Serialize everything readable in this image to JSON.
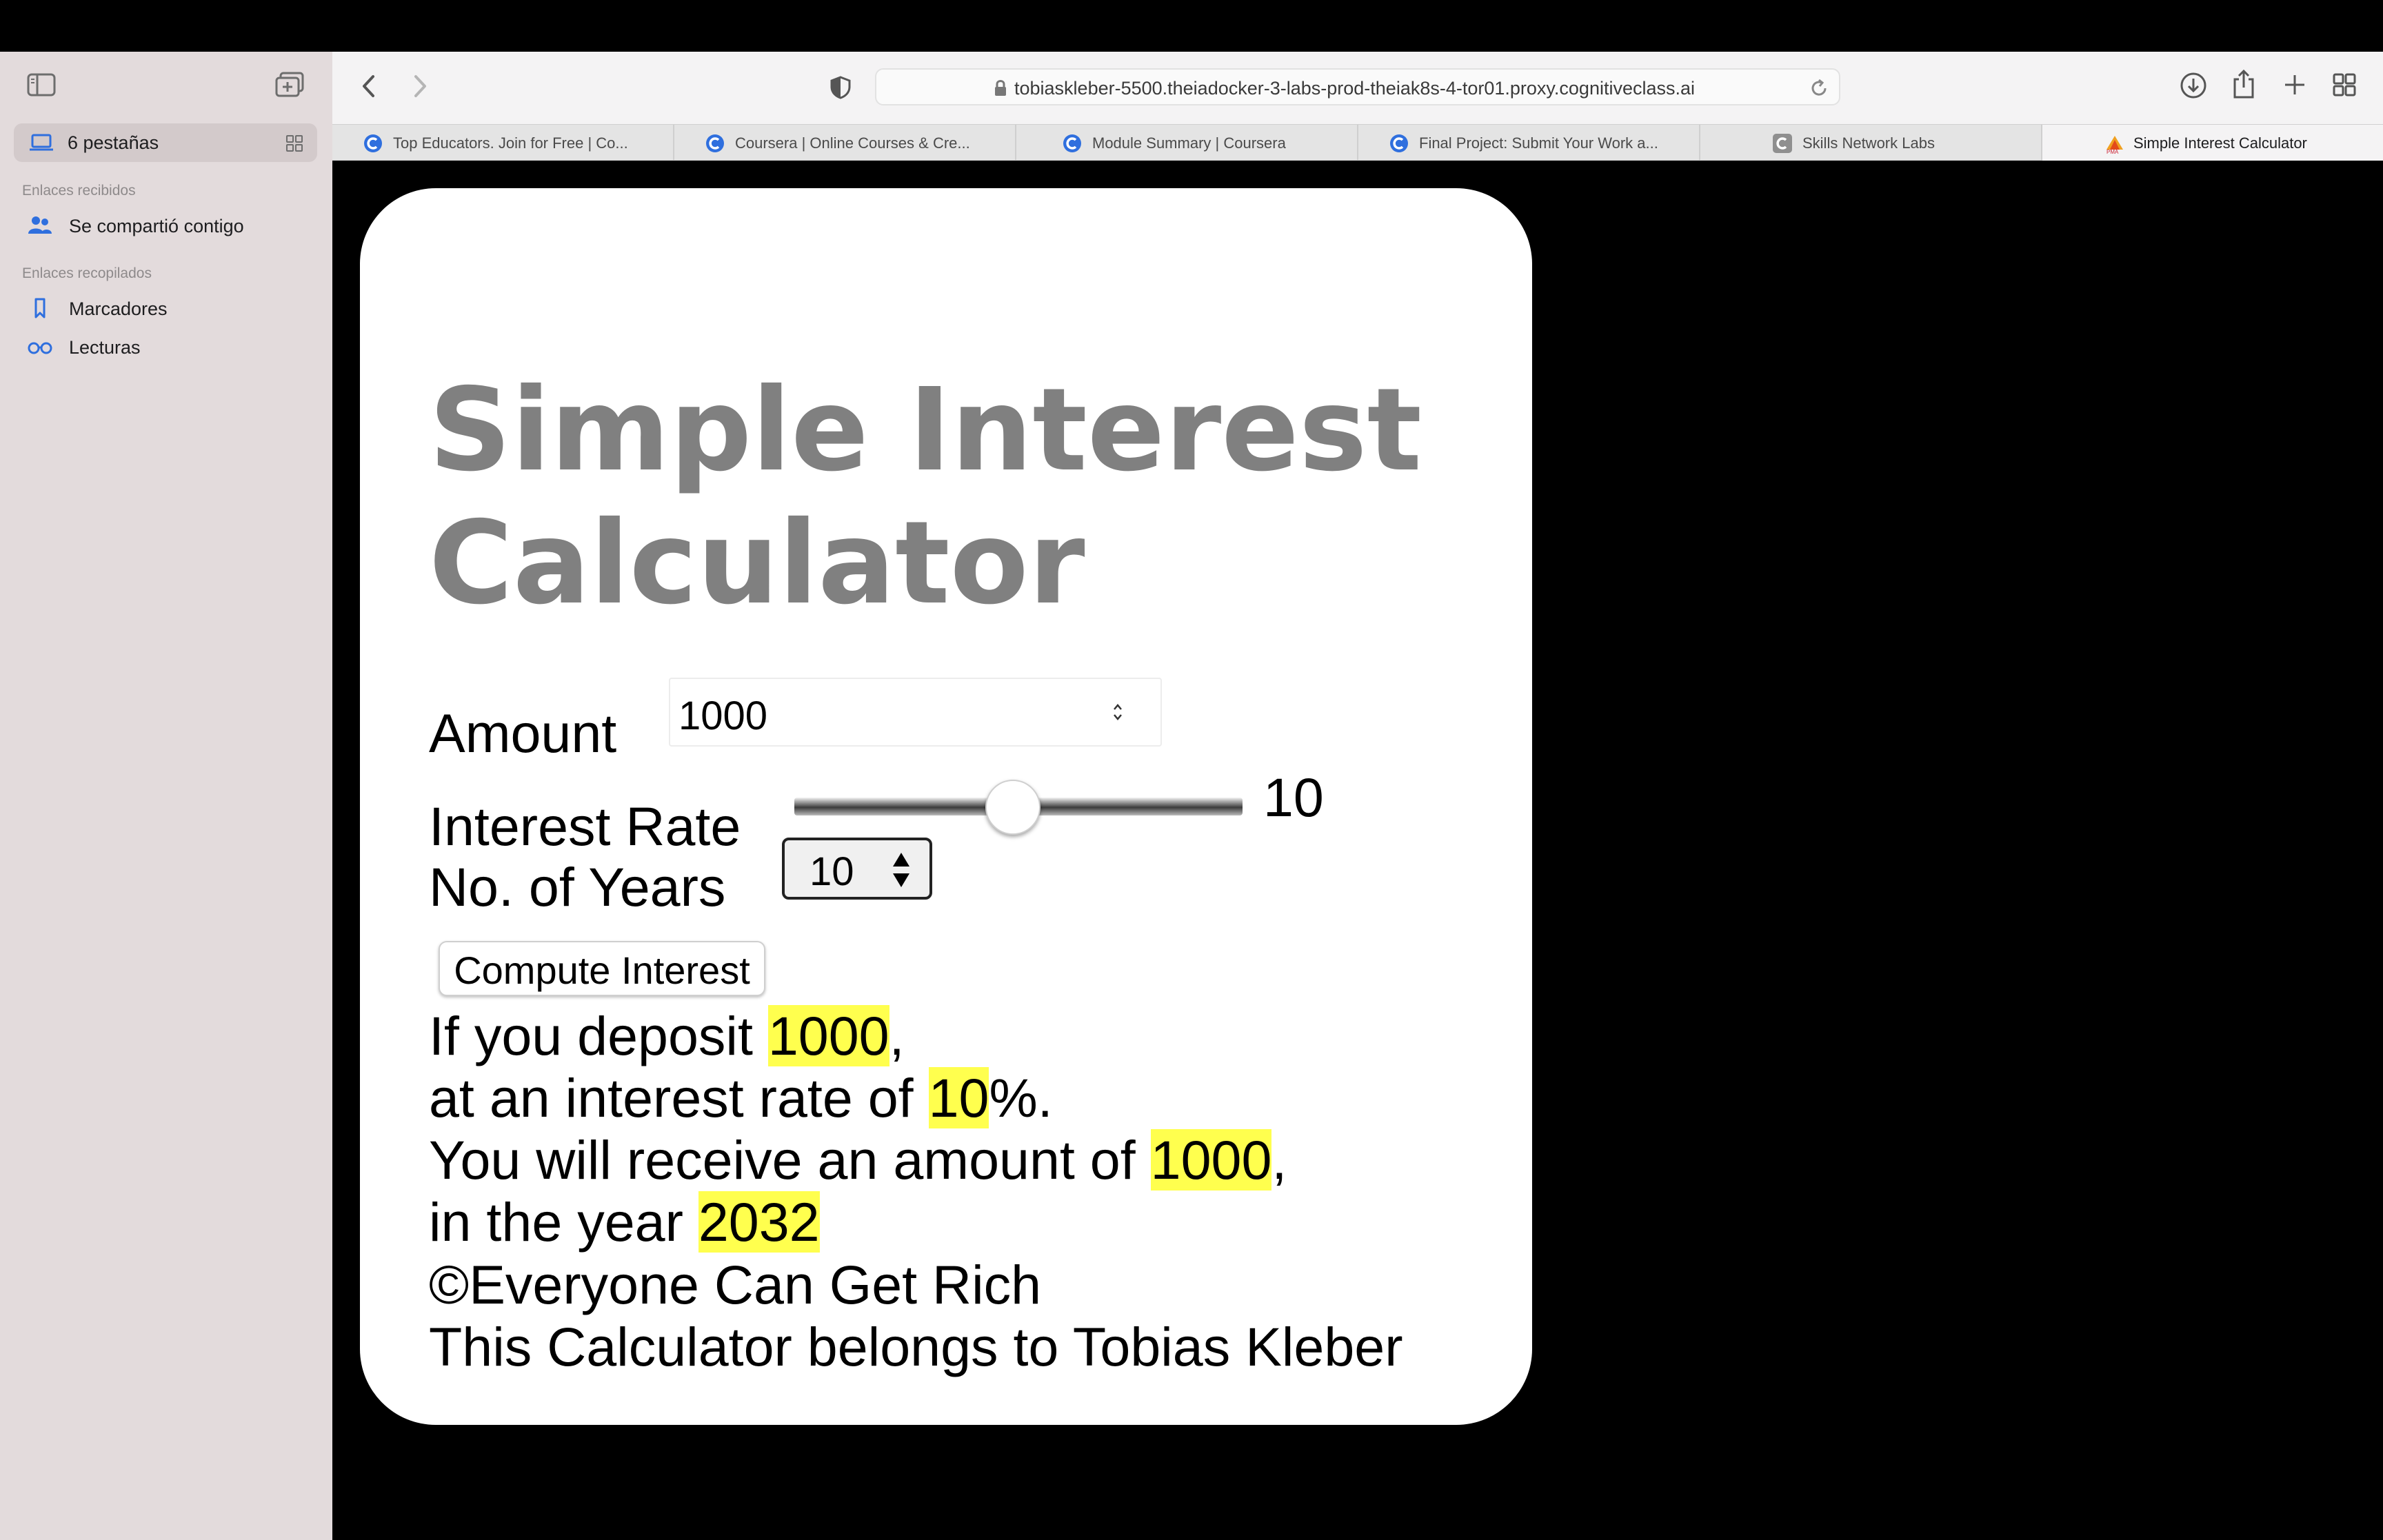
{
  "sidebar": {
    "tab_group_label": "6 pestañas",
    "section_received": "Enlaces recibidos",
    "shared_with_you": "Se compartió contigo",
    "section_collected": "Enlaces recopilados",
    "bookmarks": "Marcadores",
    "reading_list": "Lecturas"
  },
  "toolbar": {
    "url": "tobiaskleber-5500.theiadocker-3-labs-prod-theiak8s-4-tor01.proxy.cognitiveclass.ai"
  },
  "tabs": [
    {
      "title": "Top Educators. Join for Free | Co...",
      "favicon": "coursera-icon"
    },
    {
      "title": "Coursera | Online Courses & Cre...",
      "favicon": "coursera-icon"
    },
    {
      "title": "Module Summary | Coursera",
      "favicon": "coursera-icon"
    },
    {
      "title": "Final Project: Submit Your Work a...",
      "favicon": "coursera-icon"
    },
    {
      "title": "Skills Network Labs",
      "favicon": "skills-network-icon"
    },
    {
      "title": "Simple Interest Calculator",
      "favicon": "pma-icon"
    }
  ],
  "app": {
    "title": "Simple Interest Calculator",
    "amount_label": "Amount",
    "amount_value": "1000",
    "rate_label": "Interest Rate",
    "rate_value": "10",
    "rate_fraction": 0.45,
    "years_label": "No. of Years",
    "years_value": "10",
    "compute_label": "Compute Interest",
    "result": {
      "line1_prefix": "If you deposit ",
      "deposit": "1000",
      "line1_suffix": ",",
      "line2_prefix": "at an interest rate of ",
      "rate": "10",
      "line2_suffix": "%.",
      "line3_prefix": "You will receive an amount of ",
      "amount": "1000",
      "line3_suffix": ",",
      "line4_prefix": "in the year ",
      "year": "2032"
    },
    "copyright": "©Everyone Can Get Rich",
    "owner": "This Calculator belongs to Tobias Kleber"
  },
  "colors": {
    "highlight": "#ffff4e",
    "title": "#808080",
    "sidebar_bg": "#e3dbdc",
    "accent_blue": "#2f6fde"
  }
}
